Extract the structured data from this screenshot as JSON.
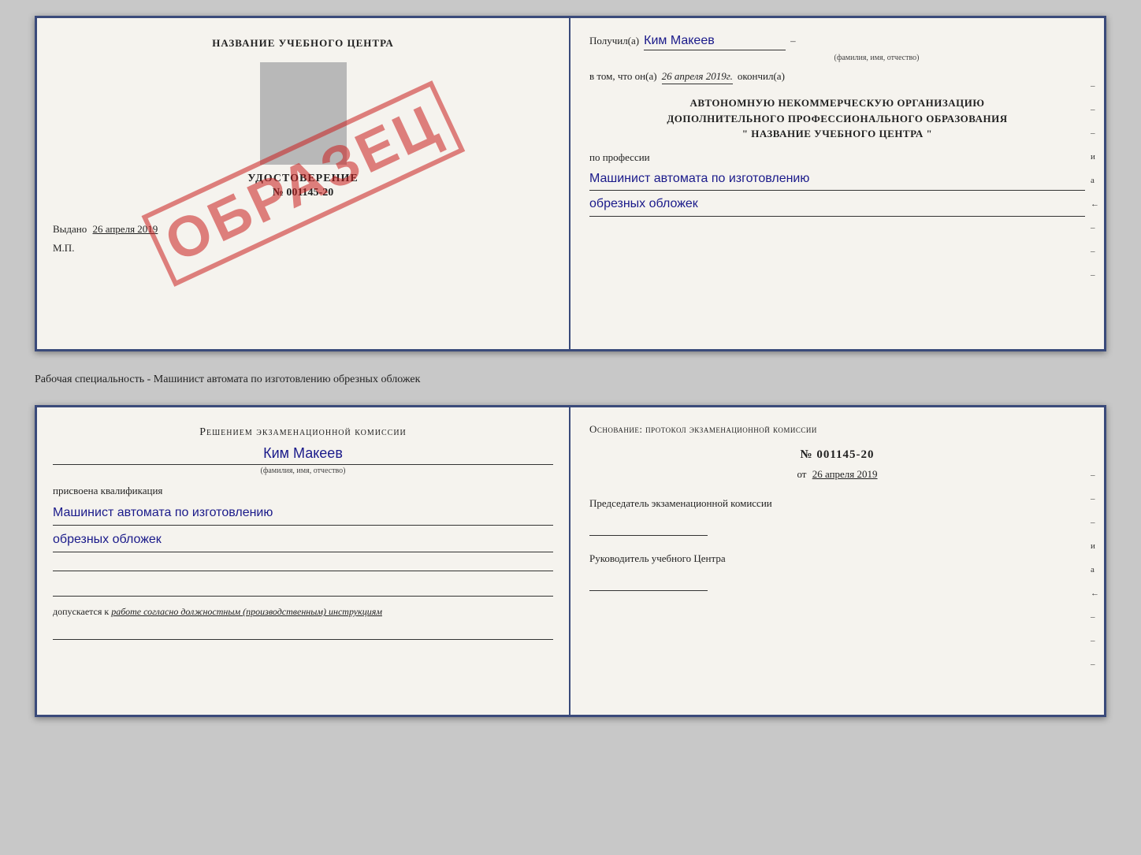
{
  "top_doc": {
    "left": {
      "title": "НАЗВАНИЕ УЧЕБНОГО ЦЕНТРА",
      "stamp": "ОБРАЗЕЦ",
      "udost_label": "УДОСТОВЕРЕНИЕ",
      "udost_number": "№ 001145-20",
      "vydano": "Выдано",
      "vydano_date": "26 апреля 2019",
      "mp": "М.П."
    },
    "right": {
      "poluchil_label": "Получил(а)",
      "poluchil_name": "Ким Макеев",
      "poluchil_dash": "–",
      "fio_hint": "(фамилия, имя, отчество)",
      "vtom_label": "в том, что он(а)",
      "vtom_date": "26 апреля 2019г.",
      "okonchil": "окончил(а)",
      "org_line1": "АВТОНОМНУЮ НЕКОММЕРЧЕСКУЮ ОРГАНИЗАЦИЮ",
      "org_line2": "ДОПОЛНИТЕЛЬНОГО ПРОФЕССИОНАЛЬНОГО ОБРАЗОВАНИЯ",
      "org_line3": "\"   НАЗВАНИЕ УЧЕБНОГО ЦЕНТРА   \"",
      "po_professii": "по профессии",
      "profession_line1": "Машинист автомата по изготовлению",
      "profession_line2": "обрезных обложек",
      "side_marks": [
        "–",
        "–",
        "–",
        "и",
        "а",
        "←",
        "–",
        "–",
        "–"
      ]
    }
  },
  "middle": {
    "description": "Рабочая специальность - Машинист автомата по изготовлению обрезных обложек"
  },
  "bottom_doc": {
    "left": {
      "resheniem_title": "Решением экзаменационной комиссии",
      "name": "Ким Макеев",
      "fio_hint": "(фамилия, имя, отчество)",
      "prisvoyena": "присвоена квалификация",
      "kvalif_line1": "Машинист автомата по изготовлению",
      "kvalif_line2": "обрезных обложек",
      "dopusk_label": "допускается к",
      "dopusk_text": "работе согласно должностным (производственным) инструкциям"
    },
    "right": {
      "osnovanie_label": "Основание: протокол экзаменационной комиссии",
      "protocol_number": "№  001145-20",
      "ot_label": "от",
      "ot_date": "26 апреля 2019",
      "predsedatel_label": "Председатель экзаменационной комиссии",
      "rukovoditel_label": "Руководитель учебного Центра",
      "side_marks": [
        "–",
        "–",
        "–",
        "и",
        "а",
        "←",
        "–",
        "–",
        "–"
      ]
    }
  }
}
